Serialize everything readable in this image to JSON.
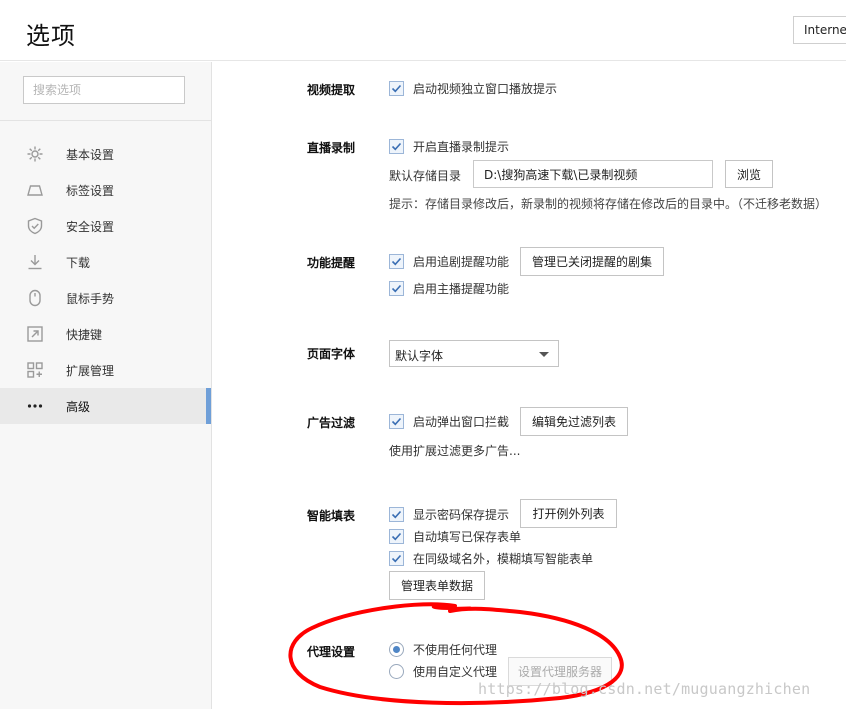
{
  "header": {
    "title": "选项",
    "dropdown_value": "Interne"
  },
  "sidebar": {
    "search_placeholder": "搜索选项",
    "items": [
      {
        "label": "基本设置",
        "icon": "gear-icon",
        "active": false
      },
      {
        "label": "标签设置",
        "icon": "tab-icon",
        "active": false
      },
      {
        "label": "安全设置",
        "icon": "shield-icon",
        "active": false
      },
      {
        "label": "下载",
        "icon": "download-icon",
        "active": false
      },
      {
        "label": "鼠标手势",
        "icon": "mouse-icon",
        "active": false
      },
      {
        "label": "快捷键",
        "icon": "shortcut-arrow-icon",
        "active": false
      },
      {
        "label": "扩展管理",
        "icon": "extensions-grid-icon",
        "active": false
      },
      {
        "label": "高级",
        "icon": "more-dots-icon",
        "active": true
      }
    ]
  },
  "sections": {
    "video": {
      "label": "视频提取",
      "option": "启动视频独立窗口播放提示"
    },
    "live": {
      "label": "直播录制",
      "option": "开启直播录制提示",
      "dir_label": "默认存储目录",
      "dir_value": "D:\\搜狗高速下载\\已录制视频",
      "browse": "浏览",
      "hint": "提示：存储目录修改后，新录制的视频将存储在修改后的目录中。（不迁移老数据）"
    },
    "reminder": {
      "label": "功能提醒",
      "option1": "启用追剧提醒功能",
      "manage_btn": "管理已关闭提醒的剧集",
      "option2": "启用主播提醒功能"
    },
    "font": {
      "label": "页面字体",
      "value": "默认字体"
    },
    "adfilter": {
      "label": "广告过滤",
      "option": "启动弹出窗口拦截",
      "edit_btn": "编辑免过滤列表",
      "more": "使用扩展过滤更多广告..."
    },
    "autofill": {
      "label": "智能填表",
      "option1": "显示密码保存提示",
      "open_btn": "打开例外列表",
      "option2": "自动填写已保存表单",
      "option3": "在同级域名外，模糊填写智能表单",
      "manage_btn": "管理表单数据"
    },
    "proxy": {
      "label": "代理设置",
      "radio1": "不使用任何代理",
      "radio2": "使用自定义代理",
      "server_btn": "设置代理服务器"
    }
  },
  "annotation": {
    "watermark": "https://blog.csdn.net/muguangzhichen",
    "circle_color": "#ff0000"
  }
}
